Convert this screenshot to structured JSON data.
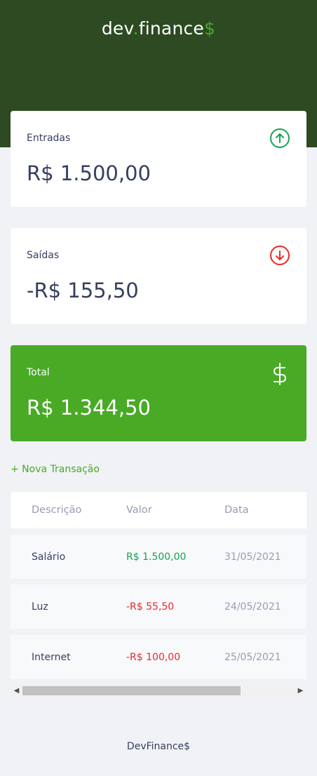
{
  "header": {
    "logo_part1": "dev",
    "logo_dot": ".",
    "logo_part2": "finance",
    "logo_dollar": "$"
  },
  "cards": {
    "income": {
      "label": "Entradas",
      "value": "R$ 1.500,00",
      "icon": "arrow-up-circle-icon",
      "icon_color": "#12a454"
    },
    "expense": {
      "label": "Saídas",
      "value": "-R$ 155,50",
      "icon": "arrow-down-circle-icon",
      "icon_color": "#e92929"
    },
    "total": {
      "label": "Total",
      "value": "R$ 1.344,50",
      "icon": "dollar-sign-icon",
      "background": "#49aa26"
    }
  },
  "new_transaction_label": "+ Nova Transação",
  "table": {
    "headers": [
      "Descrição",
      "Valor",
      "Data"
    ],
    "rows": [
      {
        "description": "Salário",
        "amount": "R$ 1.500,00",
        "date": "31/05/2021"
      },
      {
        "description": "Luz",
        "amount": "-R$ 55,50",
        "date": "24/05/2021"
      },
      {
        "description": "Internet",
        "amount": "-R$ 100,00",
        "date": "25/05/2021"
      }
    ]
  },
  "scrollbar": {
    "left_arrow": "◀",
    "right_arrow": "▶"
  },
  "footer": "DevFinance$",
  "colors": {
    "header_bg": "#2d4a22",
    "accent": "#49aa26",
    "income": "#12a454",
    "expense": "#e92929",
    "text": "#363f5f",
    "muted": "#969cb3"
  }
}
